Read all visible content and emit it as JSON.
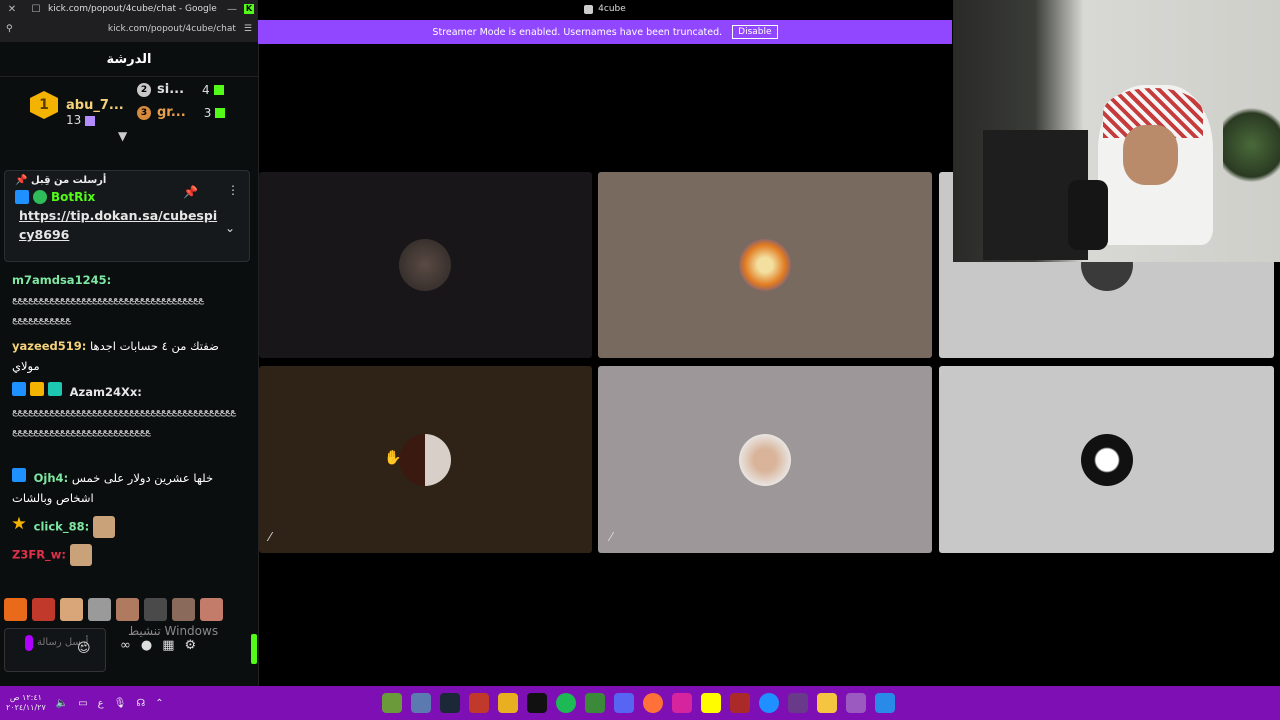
{
  "popup": {
    "title": "kick.com/popout/4cube/chat - Google Ch...",
    "url": "kick.com/popout/4cube/chat"
  },
  "window_title": "4cube",
  "streamer_banner": {
    "text": "Streamer Mode is enabled. Usernames have been truncated.",
    "button": "Disable"
  },
  "chat": {
    "header": "الدرشة",
    "leaderboard": [
      {
        "rank": "1",
        "name": "abu_7...",
        "count": "13"
      },
      {
        "rank": "2",
        "name": "si...",
        "count": "4"
      },
      {
        "rank": "3",
        "name": "gr...",
        "count": "3"
      }
    ],
    "pinned": {
      "label": "أرسلت من قِبل",
      "user": "BotRix",
      "link": "https://tip.dokan.sa/cubespicy8696"
    },
    "messages": [
      {
        "user": "m7amdsa1245:",
        "user_color": "#7ee8a3",
        "text": "ﻊﻊﻊﻊﻊﻊﻊﻊﻊﻊﻊﻊﻊﻊﻊﻊﻊﻊﻊﻊﻊﻊﻊﻊﻊﻊﻊﻊﻊﻊﻊﻊﻊﻊﻊﻊ"
      },
      {
        "user": "yazeed519:",
        "user_color": "#f5d27a",
        "text": "ضفتك من ٤ حسابات اجدها مولاي"
      },
      {
        "user": "Azam24Xx:",
        "user_color": "#e6e6e6",
        "text": "ﻊﻊﻊﻊﻊﻊﻊﻊﻊﻊﻊﻊﻊﻊﻊﻊﻊﻊﻊﻊﻊﻊﻊﻊﻊﻊﻊﻊﻊﻊﻊﻊﻊﻊﻊﻊﻊﻊﻊﻊﻊﻊﻊﻊﻊﻊﻊﻊﻊﻊﻊﻊﻊﻊﻊﻊﻊﻊﻊﻊﻊﻊﻊﻊﻊﻊﻊﻊ"
      },
      {
        "user": "Ojh4:",
        "user_color": "#7ee8a3",
        "text": "خلها عشرين دولار على خمس اشخاص وبالشات"
      },
      {
        "user": "click_88:",
        "user_color": "#7ee8a3",
        "text": ""
      },
      {
        "user": "Z3FR_w:",
        "user_color": "#e0304a",
        "text": ""
      }
    ],
    "input_placeholder": "أرسل رسالة",
    "watermark": "تنشيط Windows"
  },
  "taskbar": {
    "time": "١٢:٤١ ص",
    "date": "٢٠٢٤/١١/٢٧",
    "lang": "ع"
  },
  "colors": {
    "kick_green": "#53fc18",
    "streamer_purple": "#9147ff",
    "taskbar_purple": "#7d0fb4"
  }
}
